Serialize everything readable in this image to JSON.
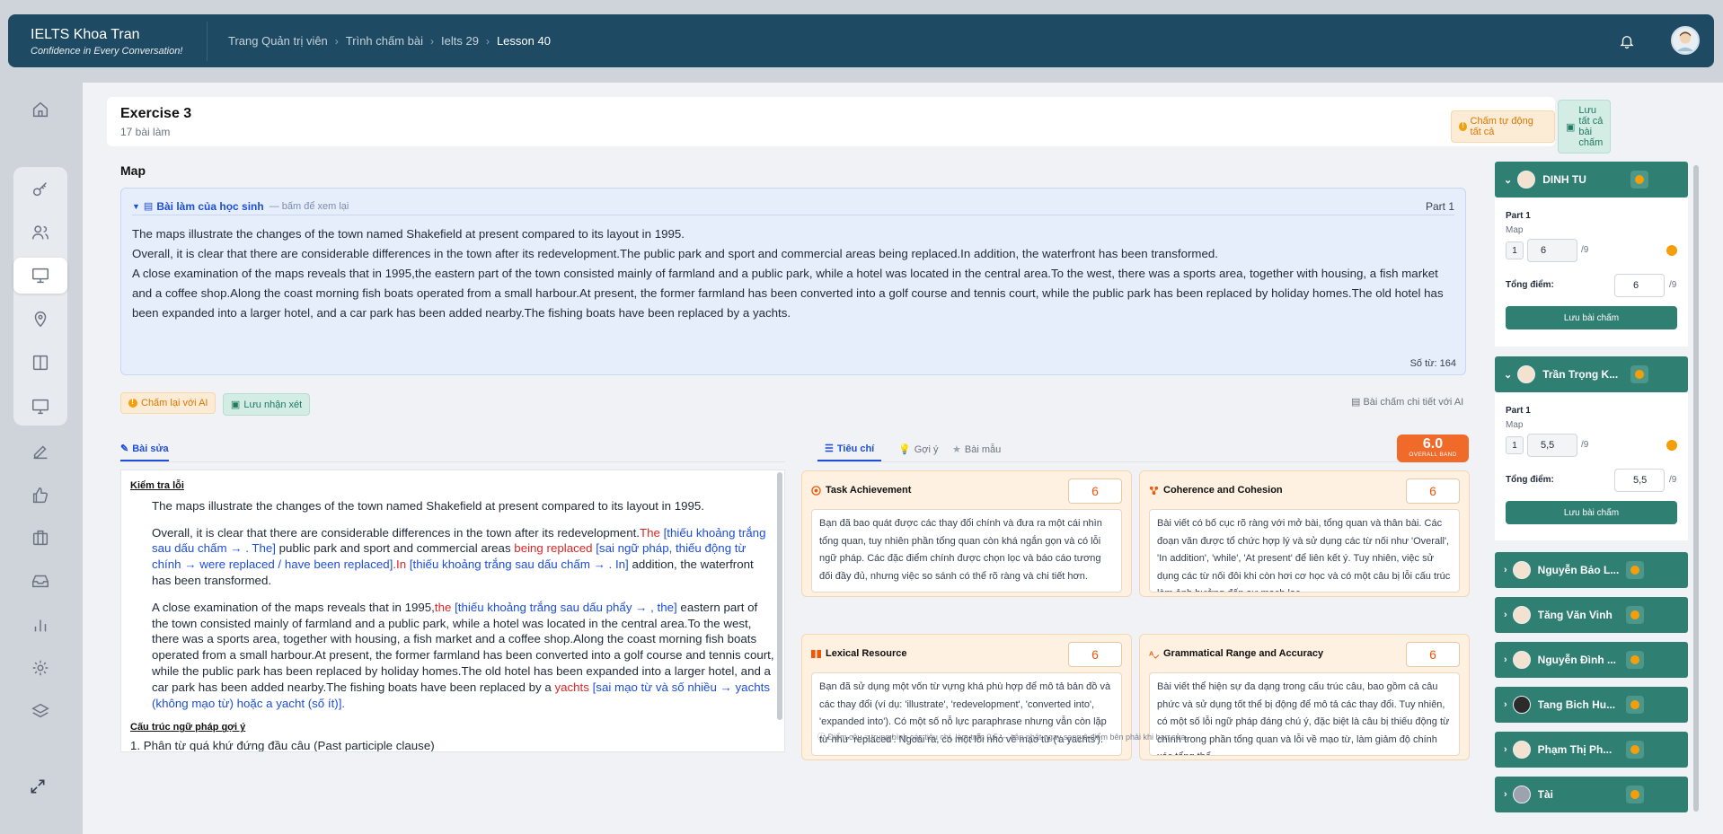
{
  "brand": {
    "title": "IELTS Khoa Tran",
    "subtitle": "Confidence in Every Conversation!"
  },
  "breadcrumb": [
    "Trang Quản trị viên",
    "Trình chấm bài",
    "Ielts 29",
    "Lesson 40"
  ],
  "sidebar": {
    "items": [
      "home-icon",
      "key-icon",
      "users-icon",
      "presentation-icon",
      "map-pin-icon",
      "book-icon",
      "monitor-icon",
      "edit-icon",
      "thumbs-up-icon",
      "briefcase-icon",
      "inbox-icon",
      "bar-chart-icon",
      "settings-icon",
      "layers-icon"
    ],
    "active": "presentation-icon"
  },
  "exercise": {
    "title": "Exercise 3",
    "subtitle": "17 bài làm",
    "auto_grade": "Chấm tự động tất cả",
    "save_all": "Lưu tất cả bài chấm"
  },
  "section_title": "Map",
  "essay": {
    "label": "Bài làm của học sinh",
    "hint": "— bấm để xem lại",
    "part": "Part 1",
    "p1": "The maps illustrate the changes of the town named Shakefield at present compared to its layout in 1995.",
    "p2": "Overall, it is clear that there are considerable differences in the town after its redevelopment.The public park and sport and commercial areas being replaced.In addition, the waterfront has been transformed.",
    "p3": "A close examination of the maps reveals that in 1995,the eastern part of the town consisted mainly of farmland and a public park, while a hotel was located in the central area.To the west, there was a sports area, together with housing, a fish market and a coffee shop.Along the coast morning fish boats operated from a small harbour.At present, the former farmland has been converted into a golf course and tennis court, while the public park has been replaced by holiday homes.The old hotel has been expanded into a larger hotel, and a car park has been added nearby.The fishing boats have been replaced by a yachts.",
    "word_count": "Số từ: 164"
  },
  "actions": {
    "regrade": "Chấm lại với AI",
    "save_comment": "Lưu nhận xét",
    "detail": "Bài chấm chi tiết với AI"
  },
  "tabs_left": {
    "fix": "Bài sửa"
  },
  "tabs_right": {
    "criteria": "Tiêu chí",
    "hint": "Gợi ý",
    "sample": "Bài mẫu"
  },
  "band": {
    "value": "6.0",
    "label": "OVERALL BAND"
  },
  "correction": {
    "heading": "Kiểm tra lỗi",
    "a1": "The maps illustrate the changes of the town named Shakefield at present compared to its layout in 1995.",
    "b1": "Overall, it is clear that there are considerable differences in the town after its redevelopment.",
    "b2": "The",
    "b3": " [thiếu khoảng trắng sau dấu chấm → . The]",
    "b4": " public park and sport and commercial areas ",
    "b5": "being replaced",
    "b6": " [sai ngữ pháp, thiếu động từ chính → were replaced / have been replaced]",
    "b7": ".In",
    "b8": " [thiếu khoảng trắng sau dấu chấm → . In]",
    "b9": " addition, the waterfront has been transformed.",
    "c1": "A close examination of the maps reveals that in 1995,",
    "c2": "the",
    "c3": " [thiếu khoảng trắng sau dấu phẩy → , the]",
    "c4": " eastern part of the town consisted mainly of farmland and a public park, while a hotel was located in the central area.To the west, there was a sports area, together with housing, a fish market and a coffee shop.Along the coast morning fish boats operated from a small harbour.At present, the former farmland has been converted into a golf course and tennis court, while the public park has been replaced by holiday homes.The old hotel has been expanded into a larger hotel, and a car park has been added nearby.The fishing boats have been replaced by a ",
    "c5": "yachts",
    "c6": " [sai mạo từ và số nhiều → yachts (không mạo từ) hoặc a yacht (số ít)].",
    "h2": "Cấu trúc ngữ pháp gợi ý",
    "d1": "1. Phân từ quá khứ đứng đầu câu (Past participle clause)"
  },
  "criteria": [
    {
      "name": "Task Achievement",
      "score": "6",
      "feedback": "Bạn đã bao quát được các thay đổi chính và đưa ra một cái nhìn tổng quan, tuy nhiên phần tổng quan còn khá ngắn gọn và có lỗi ngữ pháp. Các đặc điểm chính được chọn lọc và báo cáo tương đối đầy đủ, nhưng việc so sánh có thể rõ ràng và chi tiết hơn."
    },
    {
      "name": "Coherence and Cohesion",
      "score": "6",
      "feedback": "Bài viết có bố cục rõ ràng với mở bài, tổng quan và thân bài. Các đoạn văn được tổ chức hợp lý và sử dụng các từ nối như 'Overall', 'In addition', 'while', 'At present' để liên kết ý. Tuy nhiên, việc sử dụng các từ nối đôi khi còn hơi cơ học và có một câu bị lỗi cấu trúc làm ảnh hưởng đến sự mạch lạc."
    },
    {
      "name": "Lexical Resource",
      "score": "6",
      "feedback": "Bạn đã sử dụng một vốn từ vựng khá phù hợp để mô tả bản đồ và các thay đổi (ví dụ: 'illustrate', 'redevelopment', 'converted into', 'expanded into'). Có một số nỗ lực paraphrase nhưng vẫn còn lặp từ như 'replaced'. Ngoài ra, có một lỗi nhỏ về mạo từ ('a yachts')."
    },
    {
      "name": "Grammatical Range and Accuracy",
      "score": "6",
      "feedback": "Bài viết thể hiện sự đa dạng trong cấu trúc câu, bao gồm cả câu phức và sử dụng tốt thể bị động để mô tả các thay đổi. Tuy nhiên, có một số lỗi ngữ pháp đáng chú ý, đặc biệt là câu bị thiếu động từ chính trong phần tổng quan và lỗi về mạo từ, làm giảm độ chính xác tổng thể."
    }
  ],
  "note": "Điểm câu = trung bình các tiêu chí, làm tròn 0.5 — cập nhật ngay sang ô điểm bên phải khi bạn sửa.",
  "students": [
    {
      "name": "DINH TU",
      "expanded": true,
      "part": "Part 1",
      "task": "Map",
      "num": "1",
      "score": "6",
      "max": "/9",
      "total_label": "Tổng điểm:",
      "total": "6",
      "save": "Lưu bài chấm"
    },
    {
      "name": "Trần Trọng K...",
      "expanded": true,
      "part": "Part 1",
      "task": "Map",
      "num": "1",
      "score": "5,5",
      "max": "/9",
      "total_label": "Tổng điểm:",
      "total": "5,5",
      "save": "Lưu bài chấm"
    },
    {
      "name": "Nguyễn Bảo L...",
      "expanded": false
    },
    {
      "name": "Tăng Văn Vinh",
      "expanded": false
    },
    {
      "name": "Nguyễn Đình ...",
      "expanded": false
    },
    {
      "name": "Tang Bich Hu...",
      "expanded": false
    },
    {
      "name": "Phạm Thị Ph...",
      "expanded": false
    },
    {
      "name": "Tài",
      "expanded": false
    }
  ]
}
